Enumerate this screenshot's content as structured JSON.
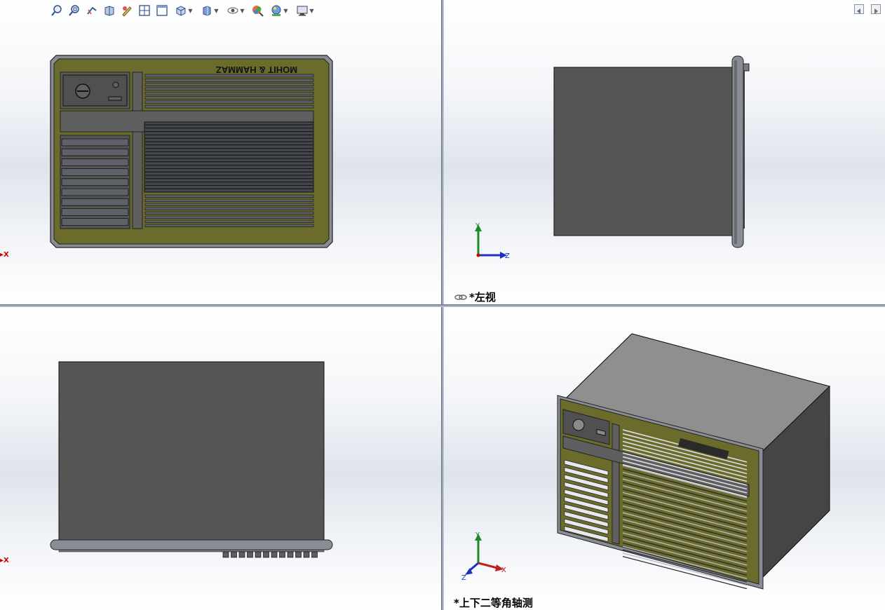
{
  "toolbar": {
    "icons": [
      "zoom-to-fit-icon",
      "zoom-area-icon",
      "previous-view-icon",
      "section-view-icon",
      "dynamic-annotation-icon",
      "four-viewport-icon",
      "single-viewport-icon",
      "view-orientation-icon",
      "display-style-icon",
      "hide-show-items-icon",
      "edit-appearance-icon",
      "apply-scene-icon",
      "view-settings-icon"
    ]
  },
  "viewports": {
    "top_left": {
      "axis_label": "X"
    },
    "top_right": {
      "label": "*左视",
      "axes": {
        "y": "Y",
        "z": "Z"
      }
    },
    "bottom_left": {
      "axis_label": "X"
    },
    "bottom_right": {
      "label": "*上下二等角轴测",
      "axes": {
        "y": "Y",
        "x": "X",
        "z": "Z"
      }
    }
  },
  "model": {
    "brand_text": "MOHIT & HAMMAZ",
    "colors": {
      "frame": "#6b6b2c",
      "casing": "#555555",
      "grille": "#44464e",
      "trim": "#7f8290"
    }
  }
}
